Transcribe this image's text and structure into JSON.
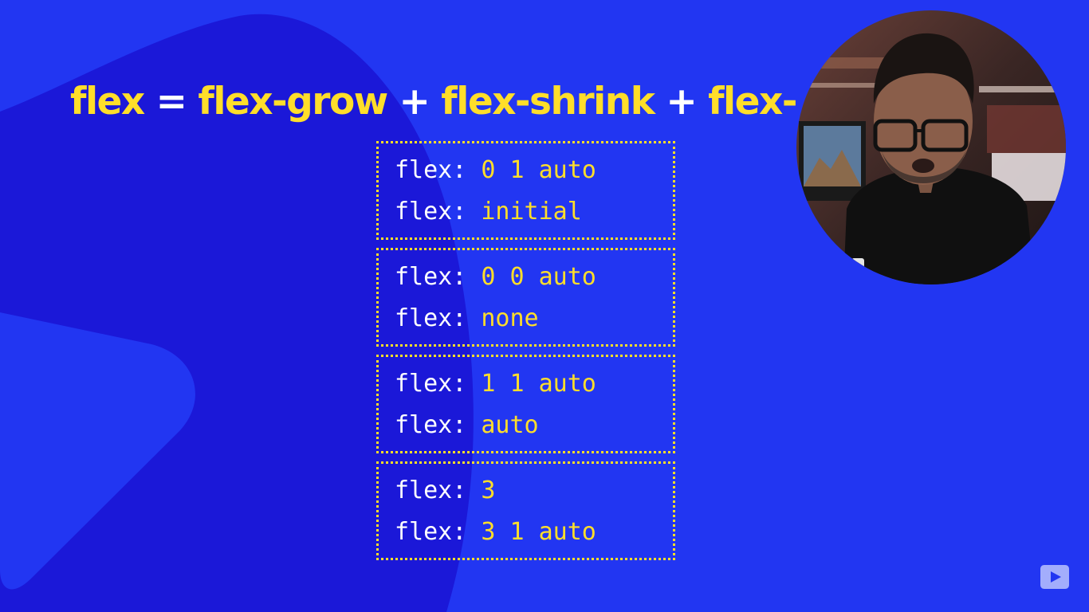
{
  "headline": {
    "parts": [
      {
        "text": "flex",
        "role": "term"
      },
      {
        "text": " = ",
        "role": "operator"
      },
      {
        "text": "flex-grow",
        "role": "term"
      },
      {
        "text": " + ",
        "role": "operator"
      },
      {
        "text": "flex-shrink",
        "role": "term"
      },
      {
        "text": " + ",
        "role": "operator"
      },
      {
        "text": "flex-",
        "role": "term"
      }
    ]
  },
  "code_boxes": [
    {
      "lines": [
        {
          "prop": "flex: ",
          "value": "0 1 auto"
        },
        {
          "prop": "flex: ",
          "value": "initial"
        }
      ]
    },
    {
      "lines": [
        {
          "prop": "flex: ",
          "value": "0 0 auto"
        },
        {
          "prop": "flex: ",
          "value": "none"
        }
      ]
    },
    {
      "lines": [
        {
          "prop": "flex: ",
          "value": "1 1 auto"
        },
        {
          "prop": "flex: ",
          "value": "auto"
        }
      ]
    },
    {
      "lines": [
        {
          "prop": "flex: ",
          "value": "3"
        },
        {
          "prop": "flex: ",
          "value": "3 1 auto"
        }
      ]
    }
  ],
  "presenter": {
    "icon": "presenter-webcam-circle"
  },
  "watermark": {
    "icon": "play-logo-icon"
  },
  "colors": {
    "background": "#2236f2",
    "background_shape": "#1b18d8",
    "accent_yellow": "#ffde2a",
    "text_white": "#ffffff"
  }
}
